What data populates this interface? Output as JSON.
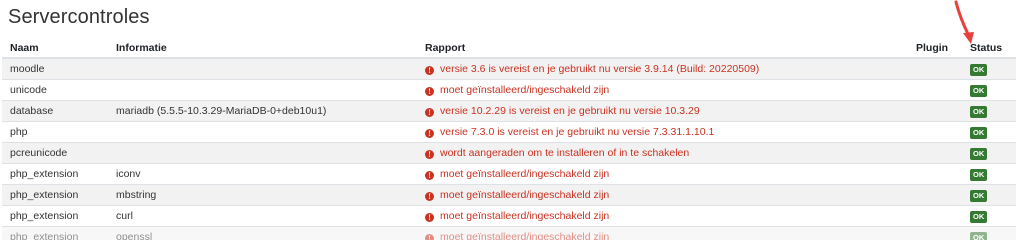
{
  "page": {
    "title": "Servercontroles"
  },
  "table": {
    "headers": {
      "name": "Naam",
      "info": "Informatie",
      "report": "Rapport",
      "plugin": "Plugin",
      "status": "Status"
    },
    "rows": [
      {
        "name": "moodle",
        "info": "",
        "report": "versie 3.6 is vereist en je gebruikt nu versie 3.9.14 (Build: 20220509)",
        "plugin": "",
        "status": "OK"
      },
      {
        "name": "unicode",
        "info": "",
        "report": "moet geïnstalleerd/ingeschakeld zijn",
        "plugin": "",
        "status": "OK"
      },
      {
        "name": "database",
        "info": "mariadb (5.5.5-10.3.29-MariaDB-0+deb10u1)",
        "report": "versie 10.2.29 is vereist en je gebruikt nu versie 10.3.29",
        "plugin": "",
        "status": "OK"
      },
      {
        "name": "php",
        "info": "",
        "report": "versie 7.3.0 is vereist en je gebruikt nu versie 7.3.31.1.10.1",
        "plugin": "",
        "status": "OK"
      },
      {
        "name": "pcreunicode",
        "info": "",
        "report": "wordt aangeraden om te installeren of in te schakelen",
        "plugin": "",
        "status": "OK"
      },
      {
        "name": "php_extension",
        "info": "iconv",
        "report": "moet geïnstalleerd/ingeschakeld zijn",
        "plugin": "",
        "status": "OK"
      },
      {
        "name": "php_extension",
        "info": "mbstring",
        "report": "moet geïnstalleerd/ingeschakeld zijn",
        "plugin": "",
        "status": "OK"
      },
      {
        "name": "php_extension",
        "info": "curl",
        "report": "moet geïnstalleerd/ingeschakeld zijn",
        "plugin": "",
        "status": "OK"
      },
      {
        "name": "php_extension",
        "info": "openssl",
        "report": "moet geïnstalleerd/ingeschakeld zijn",
        "plugin": "",
        "status": "OK"
      }
    ]
  },
  "colors": {
    "error": "#ca3120",
    "ok_badge": "#357a32",
    "arrow": "#e8403a"
  },
  "icons": {
    "report_icon": "exclamation-circle-icon",
    "annotation": "red-arrow-icon"
  }
}
